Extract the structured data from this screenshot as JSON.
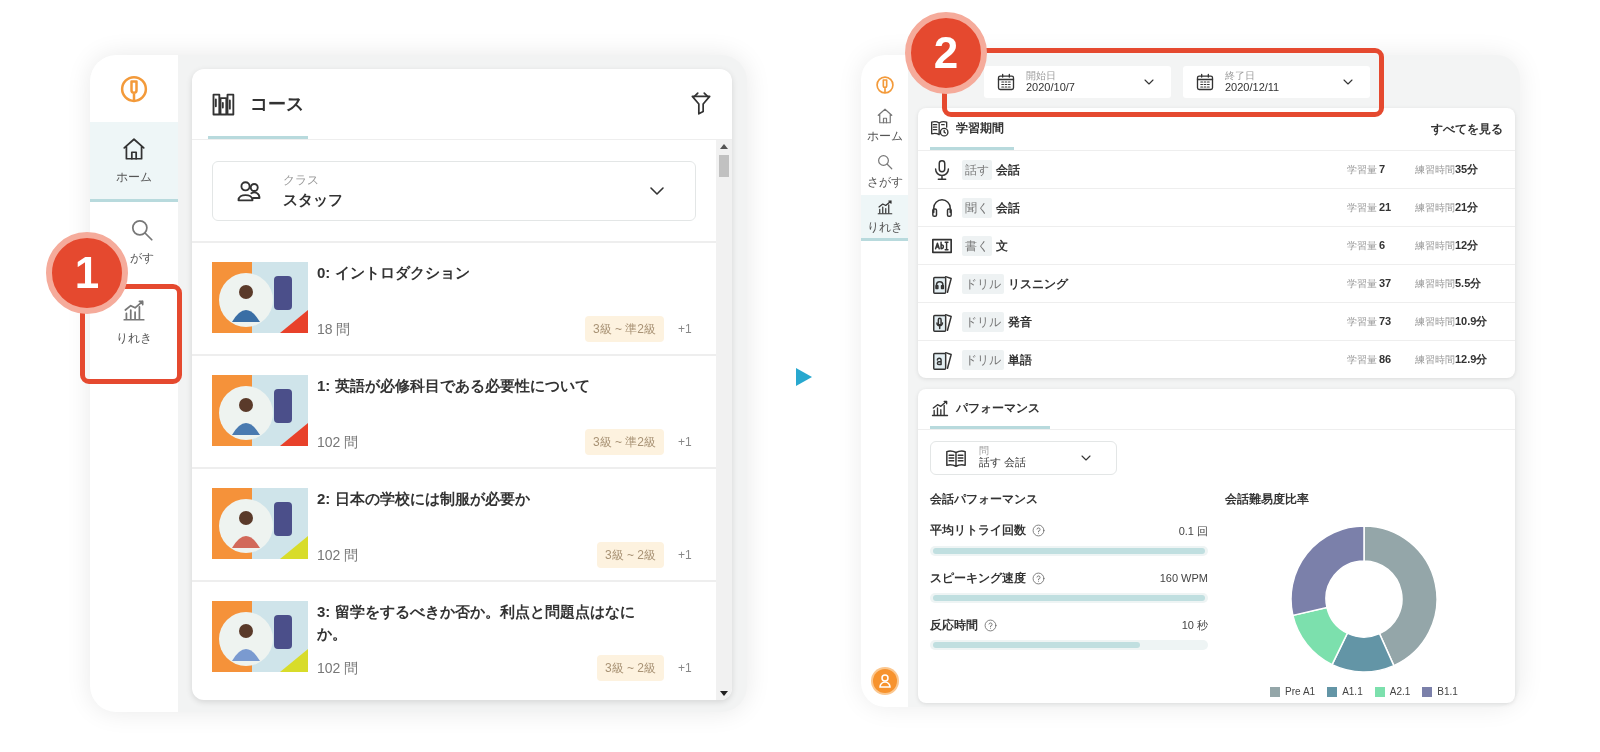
{
  "left_app": {
    "sidebar": {
      "items": [
        {
          "kind": "home",
          "label": "ホーム",
          "selected": true
        },
        {
          "kind": "search",
          "label": "がす",
          "selected": false
        },
        {
          "kind": "chart",
          "label": "りれき",
          "selected": false
        }
      ]
    },
    "header": {
      "title": "コース"
    },
    "class_select": {
      "label": "クラス",
      "value": "スタッフ"
    },
    "courses": [
      {
        "title": "0: イントロダクション",
        "count": "18 問",
        "grade": "3級 ~ 準2級",
        "more": "+1"
      },
      {
        "title": "1: 英語が必修科目である必要性について",
        "count": "102 問",
        "grade": "3級 ~ 準2級",
        "more": "+1"
      },
      {
        "title": "2: 日本の学校には制服が必要か",
        "count": "102 問",
        "grade": "3級 ~ 2級",
        "more": "+1"
      },
      {
        "title": "3: 留学をするべきか否か。利点と問題点はなにか。",
        "count": "102 問",
        "grade": "3級 ~ 2級",
        "more": "+1"
      }
    ]
  },
  "right_app": {
    "sidebar": {
      "items": [
        {
          "kind": "home",
          "label": "ホーム",
          "selected": false
        },
        {
          "kind": "search",
          "label": "さがす",
          "selected": false
        },
        {
          "kind": "chart",
          "label": "りれき",
          "selected": true
        }
      ]
    },
    "date_range": [
      {
        "label": "開始日",
        "value": "2020/10/7"
      },
      {
        "label": "終了日",
        "value": "2020/12/11"
      }
    ],
    "study_period": {
      "title": "学習期間",
      "link": "すべてを見る",
      "rows": [
        {
          "kind": "mic",
          "tag": "話す",
          "name": "会話",
          "amount_label": "学習量",
          "amount": "7",
          "time_label": "練習時間",
          "time": "35分"
        },
        {
          "kind": "headphones",
          "tag": "聞く",
          "name": "会話",
          "amount_label": "学習量",
          "amount": "21",
          "time_label": "練習時間",
          "time": "21分"
        },
        {
          "kind": "text",
          "tag": "書く",
          "name": "文",
          "amount_label": "学習量",
          "amount": "6",
          "time_label": "練習時間",
          "time": "12分"
        },
        {
          "kind": "drill_listen",
          "tag": "ドリル",
          "name": "リスニング",
          "amount_label": "学習量",
          "amount": "37",
          "time_label": "練習時間",
          "time": "5.5分"
        },
        {
          "kind": "drill_speak",
          "tag": "ドリル",
          "name": "発音",
          "amount_label": "学習量",
          "amount": "73",
          "time_label": "練習時間",
          "time": "10.9分"
        },
        {
          "kind": "drill_word",
          "tag": "ドリル",
          "name": "単語",
          "amount_label": "学習量",
          "amount": "86",
          "time_label": "練習時間",
          "time": "12.9分"
        }
      ]
    },
    "performance": {
      "title": "パフォーマンス",
      "select": {
        "label": "問",
        "value": "話す 会話"
      },
      "metrics_title": "会話パフォーマンス",
      "metrics": [
        {
          "label": "平均リトライ回数",
          "value": "0.1 回",
          "level": 1
        },
        {
          "label": "スピーキング速度",
          "value": "160 WPM",
          "level": 1
        },
        {
          "label": "反応時間",
          "value": "10 秒",
          "level": 0.76
        }
      ],
      "ratio_title": "会話難易度比率",
      "legend": [
        {
          "name": "Pre A1",
          "color": "#94a6a9"
        },
        {
          "name": "A1.1",
          "color": "#6395a6"
        },
        {
          "name": "A2.1",
          "color": "#7ce0ad"
        },
        {
          "name": "B1.1",
          "color": "#7b80aa"
        }
      ]
    }
  },
  "callouts": [
    {
      "number": "1"
    },
    {
      "number": "2"
    }
  ]
}
